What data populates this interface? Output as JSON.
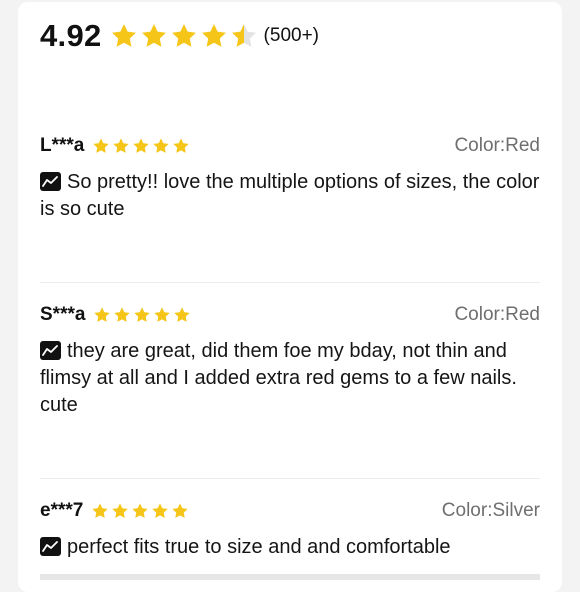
{
  "summary": {
    "rating": "4.92",
    "stars": 4.5,
    "count": "(500+)"
  },
  "reviews": [
    {
      "reviewer": "L***a",
      "stars": 5,
      "variant": "Color:Red",
      "text": "So pretty!! love the multiple options of sizes, the color is so cute"
    },
    {
      "reviewer": "S***a",
      "stars": 5,
      "variant": "Color:Red",
      "text": "they are great, did them foe my bday, not thin and flimsy at all and I added extra red gems to a few nails. cute"
    },
    {
      "reviewer": "e***7",
      "stars": 5,
      "variant": "Color:Silver",
      "text": "perfect fits true to size and and comfortable"
    }
  ],
  "colors": {
    "star": "#f5c518",
    "star_empty": "#e3e3e3",
    "variant_text": "#6f6f6f"
  },
  "icons": {
    "star": "star-icon",
    "translate": "translate-icon"
  }
}
